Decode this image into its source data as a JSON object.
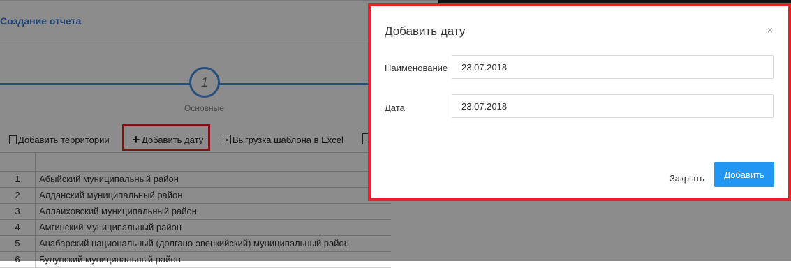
{
  "page": {
    "title": "Создание отчета",
    "wizard_step_number": "1",
    "wizard_step_label": "Основные"
  },
  "toolbar": {
    "add_territory": "Добавить территории",
    "add_date": "Добавить дату",
    "export_template": "Выгрузка шаблона в Excel",
    "xls_icon_glyph": "x"
  },
  "grid": {
    "rows": [
      {
        "num": "1",
        "name": "Абыйский муниципальный район"
      },
      {
        "num": "2",
        "name": "Алданский муниципальный район"
      },
      {
        "num": "3",
        "name": "Аллаиховский муниципальный район"
      },
      {
        "num": "4",
        "name": "Амгинский муниципальный район"
      },
      {
        "num": "5",
        "name": "Анабарский национальный (долгано-эвенкийский) муниципальный район"
      },
      {
        "num": "6",
        "name": "Булунский муниципальный район"
      }
    ]
  },
  "modal": {
    "title": "Добавить дату",
    "close_symbol": "×",
    "name_label": "Наименование",
    "name_value": "23.07.2018",
    "date_label": "Дата",
    "date_value": "23.07.2018",
    "close_button": "Закрыть",
    "add_button": "Добавить"
  },
  "colors": {
    "accent": "#2196f3",
    "highlight": "#e8202a",
    "link": "#3a7bc8"
  }
}
